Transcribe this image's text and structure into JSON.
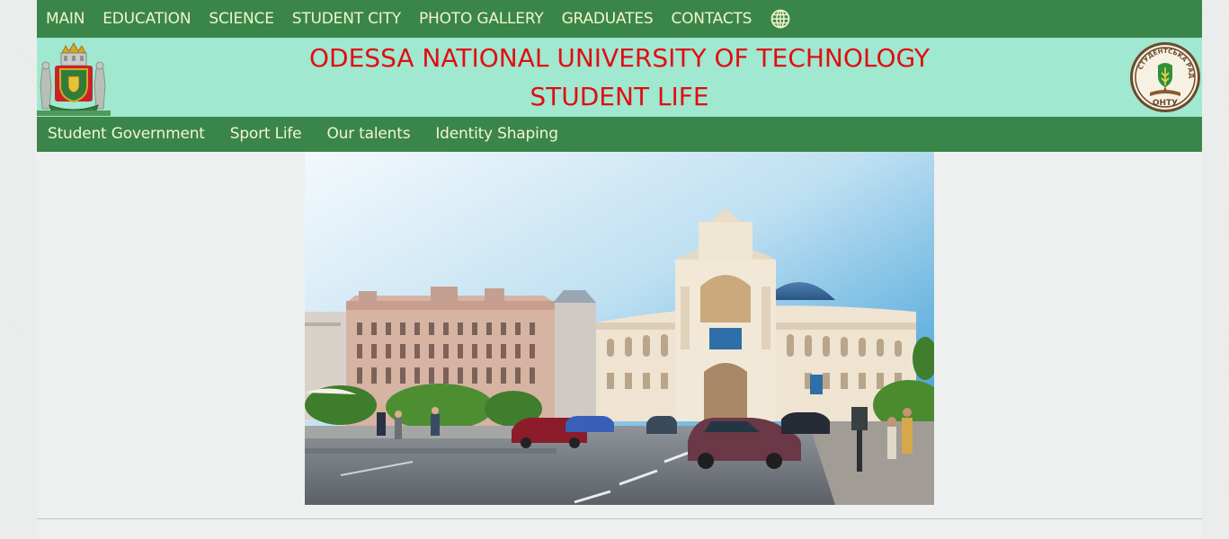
{
  "top_nav": {
    "items": [
      {
        "label": "MAIN"
      },
      {
        "label": "EDUCATION"
      },
      {
        "label": "SCIENCE"
      },
      {
        "label": "STUDENT CITY"
      },
      {
        "label": "PHOTO GALLERY"
      },
      {
        "label": "GRADUATES"
      },
      {
        "label": "CONTACTS"
      }
    ],
    "language_icon": "globe-icon"
  },
  "banner": {
    "title": "ODESSA NATIONAL UNIVERSITY OF TECHNOLOGY",
    "subtitle": "STUDENT LIFE",
    "title_color": "#e10d12",
    "background": "#a0e8cf"
  },
  "logos": {
    "right_seal_text": "ОНТУ"
  },
  "sub_nav": {
    "items": [
      {
        "label": "Student Government"
      },
      {
        "label": "Sport Life"
      },
      {
        "label": "Our talents"
      },
      {
        "label": "Identity Shaping"
      }
    ]
  },
  "colors": {
    "nav": "#3a854a",
    "nav_text": "#f1f6c8",
    "page": "#eef0ef"
  }
}
